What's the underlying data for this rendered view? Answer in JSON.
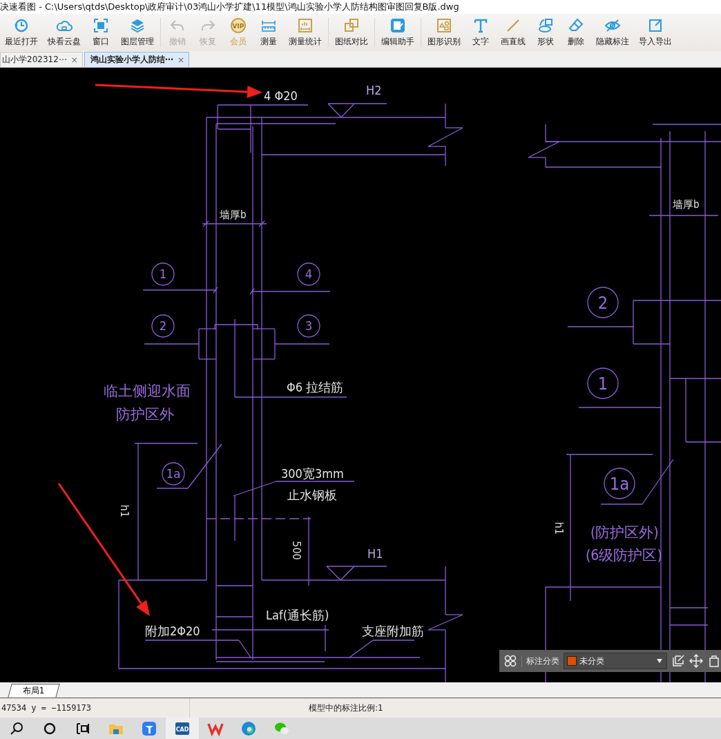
{
  "window": {
    "title": "决速看图 - C:\\Users\\qtds\\Desktop\\政府审计\\03鸿山小学扩建\\11模型\\鸿山实验小学人防结构图审图回复B版.dwg"
  },
  "toolbar": {
    "items": [
      {
        "label": "最近打开",
        "kind": "recent",
        "disabled": false
      },
      {
        "label": "快看云盘",
        "kind": "cloud",
        "disabled": false
      },
      {
        "label": "窗口",
        "kind": "window",
        "disabled": false
      },
      {
        "label": "图层管理",
        "kind": "layers",
        "disabled": false,
        "separator_after": true
      },
      {
        "label": "撤销",
        "kind": "undo",
        "disabled": true
      },
      {
        "label": "恢复",
        "kind": "redo",
        "disabled": true
      },
      {
        "label": "会员",
        "kind": "vip",
        "badge": "VIP",
        "disabled": false
      },
      {
        "label": "测量",
        "kind": "measure",
        "disabled": false
      },
      {
        "label": "测量统计",
        "kind": "stats",
        "disabled": false,
        "separator_after": true
      },
      {
        "label": "图纸对比",
        "kind": "compare",
        "disabled": false,
        "separator_after": true
      },
      {
        "label": "编辑助手",
        "kind": "cad",
        "disabled": false,
        "separator_after": true
      },
      {
        "label": "图形识别",
        "kind": "shapes",
        "disabled": false
      },
      {
        "label": "文字",
        "kind": "text",
        "disabled": false
      },
      {
        "label": "画直线",
        "kind": "line",
        "disabled": false
      },
      {
        "label": "形状",
        "kind": "shape",
        "disabled": false
      },
      {
        "label": "删除",
        "kind": "eraser",
        "disabled": false
      },
      {
        "label": "隐藏标注",
        "kind": "hide",
        "disabled": false
      },
      {
        "label": "导入导出",
        "kind": "export",
        "disabled": false
      }
    ]
  },
  "tabs": [
    {
      "label": "山小学202312⋯",
      "close": "×",
      "selected": false
    },
    {
      "label": "鸿山实验小学人防结⋯",
      "close": "×",
      "selected": true
    }
  ],
  "drawing": {
    "labels": [
      {
        "text": "4 Φ20",
        "kind": "note"
      },
      {
        "text": "H2",
        "kind": "level"
      },
      {
        "text": "墙厚b",
        "kind": "note"
      },
      {
        "text": "Φ6 拉结筋",
        "kind": "note"
      },
      {
        "text": "临土侧迎水面",
        "kind": "zone"
      },
      {
        "text": "防护区外",
        "kind": "zone"
      },
      {
        "text": "300宽3mm",
        "kind": "note"
      },
      {
        "text": "止水钢板",
        "kind": "note"
      },
      {
        "text": "h1",
        "kind": "dimension"
      },
      {
        "text": "500",
        "kind": "dimension"
      },
      {
        "text": "H1",
        "kind": "level"
      },
      {
        "text": "Laf(通长筋)",
        "kind": "note"
      },
      {
        "text": "附加2Φ20",
        "kind": "note"
      },
      {
        "text": "支座附加筋",
        "kind": "note"
      },
      {
        "text": "墙厚b",
        "kind": "note"
      },
      {
        "text": "h1",
        "kind": "dimension"
      },
      {
        "text": "(防护区外)",
        "kind": "zone"
      },
      {
        "text": "(6级防护区)",
        "kind": "zone"
      }
    ],
    "bubbles": [
      {
        "text": "1"
      },
      {
        "text": "4"
      },
      {
        "text": "2"
      },
      {
        "text": "3"
      },
      {
        "text": "1a"
      },
      {
        "text": "2"
      },
      {
        "text": "1"
      },
      {
        "text": "1a"
      }
    ]
  },
  "annotation_bar": {
    "label": "标注分类",
    "category": {
      "text": "未分类",
      "color": "#e04e00"
    }
  },
  "layout_tabs": [
    {
      "label": "布局1",
      "selected": true
    }
  ],
  "status_bar": {
    "coordinates": "47534 y = −1159173",
    "scale": "模型中的标注比例:1"
  },
  "taskbar": {
    "apps": [
      {
        "kind": "search",
        "selected": false
      },
      {
        "kind": "cortana",
        "selected": false
      },
      {
        "kind": "taskview",
        "selected": false
      },
      {
        "kind": "explorer",
        "selected": false
      },
      {
        "kind": "blueapp",
        "selected": false
      },
      {
        "kind": "cad",
        "badge": "CAD",
        "selected": true
      },
      {
        "kind": "wps",
        "selected": false
      },
      {
        "kind": "edge",
        "selected": false
      },
      {
        "kind": "wechat",
        "selected": false
      }
    ]
  }
}
